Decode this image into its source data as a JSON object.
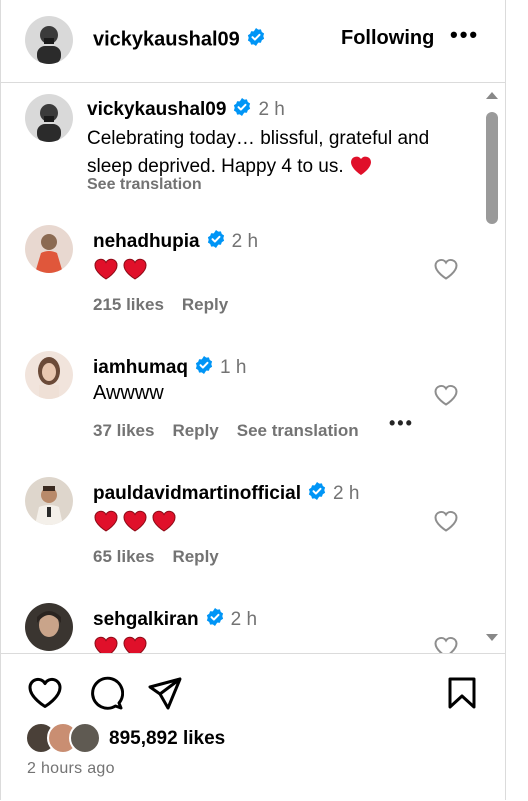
{
  "header": {
    "username": "vickykaushal09",
    "follow_label": "Following",
    "more_label": "•••"
  },
  "post": {
    "username": "vickykaushal09",
    "time": "2 h",
    "caption": "Celebrating today… blissful, grateful and sleep deprived. Happy 4 to us.",
    "see_translation": "See translation"
  },
  "comments": [
    {
      "username": "nehadhupia",
      "time": "2 h",
      "text": "",
      "hearts": 2,
      "likes": "215 likes",
      "reply": "Reply",
      "see_translation": ""
    },
    {
      "username": "iamhumaq",
      "time": "1 h",
      "text": "Awwww",
      "hearts": 0,
      "likes": "37 likes",
      "reply": "Reply",
      "see_translation": "See translation",
      "more": "•••"
    },
    {
      "username": "pauldavidmartinofficial",
      "time": "2 h",
      "text": "",
      "hearts": 3,
      "likes": "65 likes",
      "reply": "Reply",
      "see_translation": ""
    },
    {
      "username": "sehgalkiran",
      "time": "2 h",
      "text": "",
      "hearts": 2,
      "likes": "",
      "reply": "",
      "see_translation": ""
    }
  ],
  "footer": {
    "likes": "895,892 likes",
    "posted": "2 hours ago"
  },
  "colors": {
    "heart": "#e0102a",
    "verified": "#0095f6",
    "muted": "#737373"
  },
  "icons": [
    "heart-icon",
    "comment-icon",
    "share-icon",
    "bookmark-icon",
    "verified-badge-icon",
    "more-icon"
  ]
}
